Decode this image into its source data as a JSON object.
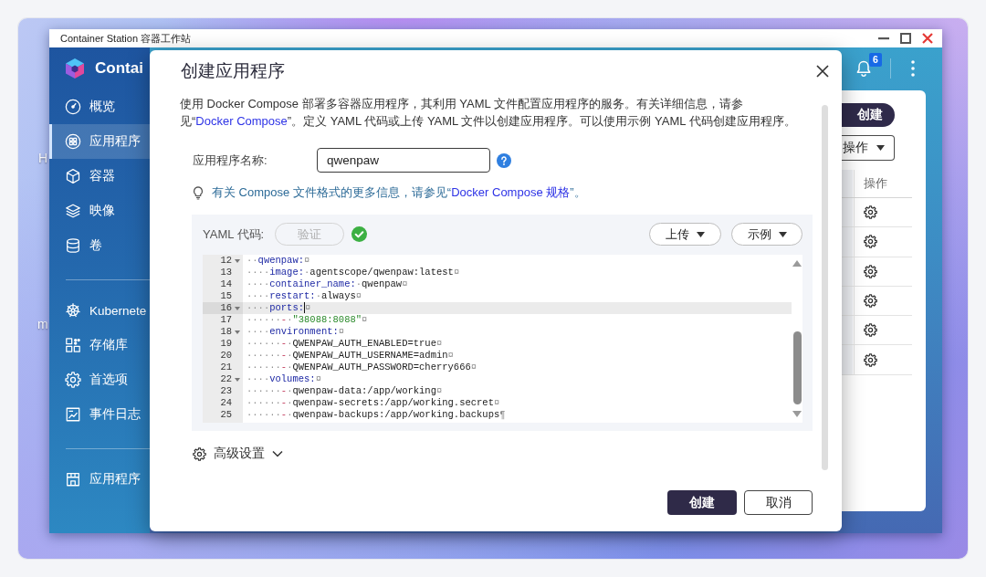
{
  "desktop": {
    "icon_labels": [
      "H",
      "m"
    ]
  },
  "window": {
    "title": "Container Station 容器工作站"
  },
  "sidebar": {
    "app_name": "Contai",
    "sections": [
      {
        "items": [
          {
            "label": "概览",
            "selected": false
          },
          {
            "label": "应用程序",
            "selected": true
          },
          {
            "label": "容器",
            "selected": false
          },
          {
            "label": "映像",
            "selected": false
          },
          {
            "label": "卷",
            "selected": false
          }
        ]
      },
      {
        "items": [
          {
            "label": "Kubernete",
            "selected": false
          },
          {
            "label": "存储库",
            "selected": false
          },
          {
            "label": "首选项",
            "selected": false
          },
          {
            "label": "事件日志",
            "selected": false
          }
        ]
      },
      {
        "items": [
          {
            "label": "应用程序",
            "selected": false
          }
        ]
      }
    ]
  },
  "header": {
    "notification_badge": "6"
  },
  "content": {
    "create_button": "创建",
    "actions_button": "操作",
    "table": {
      "columns": [
        "操作"
      ],
      "rows": [
        {
          "actions": true
        },
        {
          "actions": true
        },
        {
          "actions": true
        },
        {
          "actions": true
        },
        {
          "actions": true
        },
        {
          "actions": true
        }
      ]
    }
  },
  "dialog": {
    "title": "创建应用程序",
    "description": {
      "before": "使用 Docker Compose 部署多容器应用程序，其利用 YAML 文件配置应用程序的服务。有关详细信息，请参见“",
      "link": "Docker Compose",
      "after": "”。定义 YAML 代码或上传 YAML 文件以创建应用程序。可以使用示例 YAML 代码创建应用程序。"
    },
    "name_field": {
      "label": "应用程序名称:",
      "value": "qwenpaw"
    },
    "hint": {
      "before": "有关 Compose 文件格式的更多信息，请参见“",
      "link": "Docker Compose 规格",
      "after": "”。"
    },
    "yaml": {
      "label": "YAML 代码:",
      "validate_button": {
        "label": "验证",
        "disabled": true
      },
      "valid": true,
      "upload_button": "上传",
      "example_button": "示例",
      "editor": {
        "lines": [
          {
            "number": "12",
            "foldable": true,
            "active": false,
            "tokens": [
              {
                "kind": "ws",
                "text": "··"
              },
              {
                "kind": "key",
                "text": "qwenpaw:"
              },
              {
                "kind": "eol",
                "text": "¤"
              }
            ]
          },
          {
            "number": "13",
            "foldable": false,
            "active": false,
            "tokens": [
              {
                "kind": "ws",
                "text": "····"
              },
              {
                "kind": "key",
                "text": "image:"
              },
              {
                "kind": "ws",
                "text": "·"
              },
              {
                "kind": "plain",
                "text": "agentscope/qwenpaw:latest"
              },
              {
                "kind": "eol",
                "text": "¤"
              }
            ]
          },
          {
            "number": "14",
            "foldable": false,
            "active": false,
            "tokens": [
              {
                "kind": "ws",
                "text": "····"
              },
              {
                "kind": "key",
                "text": "container_name:"
              },
              {
                "kind": "ws",
                "text": "·"
              },
              {
                "kind": "plain",
                "text": "qwenpaw"
              },
              {
                "kind": "eol",
                "text": "¤"
              }
            ]
          },
          {
            "number": "15",
            "foldable": false,
            "active": false,
            "tokens": [
              {
                "kind": "ws",
                "text": "····"
              },
              {
                "kind": "key",
                "text": "restart:"
              },
              {
                "kind": "ws",
                "text": "·"
              },
              {
                "kind": "plain",
                "text": "always"
              },
              {
                "kind": "eol",
                "text": "¤"
              }
            ]
          },
          {
            "number": "16",
            "foldable": true,
            "active": true,
            "tokens": [
              {
                "kind": "ws",
                "text": "····"
              },
              {
                "kind": "key",
                "text": "ports:"
              },
              {
                "kind": "eol",
                "text": "¤"
              }
            ]
          },
          {
            "number": "17",
            "foldable": false,
            "active": false,
            "tokens": [
              {
                "kind": "ws",
                "text": "······"
              },
              {
                "kind": "dash",
                "text": "-"
              },
              {
                "kind": "ws",
                "text": "·"
              },
              {
                "kind": "string",
                "text": "\"38088:8088\""
              },
              {
                "kind": "eol",
                "text": "¤"
              }
            ]
          },
          {
            "number": "18",
            "foldable": true,
            "active": false,
            "tokens": [
              {
                "kind": "ws",
                "text": "····"
              },
              {
                "kind": "key",
                "text": "environment:"
              },
              {
                "kind": "eol",
                "text": "¤"
              }
            ]
          },
          {
            "number": "19",
            "foldable": false,
            "active": false,
            "tokens": [
              {
                "kind": "ws",
                "text": "······"
              },
              {
                "kind": "dash",
                "text": "-"
              },
              {
                "kind": "ws",
                "text": "·"
              },
              {
                "kind": "plain",
                "text": "QWENPAW_AUTH_ENABLED=true"
              },
              {
                "kind": "eol",
                "text": "¤"
              }
            ]
          },
          {
            "number": "20",
            "foldable": false,
            "active": false,
            "tokens": [
              {
                "kind": "ws",
                "text": "······"
              },
              {
                "kind": "dash",
                "text": "-"
              },
              {
                "kind": "ws",
                "text": "·"
              },
              {
                "kind": "plain",
                "text": "QWENPAW_AUTH_USERNAME=admin"
              },
              {
                "kind": "eol",
                "text": "¤"
              }
            ]
          },
          {
            "number": "21",
            "foldable": false,
            "active": false,
            "tokens": [
              {
                "kind": "ws",
                "text": "······"
              },
              {
                "kind": "dash",
                "text": "-"
              },
              {
                "kind": "ws",
                "text": "·"
              },
              {
                "kind": "plain",
                "text": "QWENPAW_AUTH_PASSWORD=cherry666"
              },
              {
                "kind": "eol",
                "text": "¤"
              }
            ]
          },
          {
            "number": "22",
            "foldable": true,
            "active": false,
            "tokens": [
              {
                "kind": "ws",
                "text": "····"
              },
              {
                "kind": "key",
                "text": "volumes:"
              },
              {
                "kind": "eol",
                "text": "¤"
              }
            ]
          },
          {
            "number": "23",
            "foldable": false,
            "active": false,
            "tokens": [
              {
                "kind": "ws",
                "text": "······"
              },
              {
                "kind": "dash",
                "text": "-"
              },
              {
                "kind": "ws",
                "text": "·"
              },
              {
                "kind": "plain",
                "text": "qwenpaw-data:/app/working"
              },
              {
                "kind": "eol",
                "text": "¤"
              }
            ]
          },
          {
            "number": "24",
            "foldable": false,
            "active": false,
            "tokens": [
              {
                "kind": "ws",
                "text": "······"
              },
              {
                "kind": "dash",
                "text": "-"
              },
              {
                "kind": "ws",
                "text": "·"
              },
              {
                "kind": "plain",
                "text": "qwenpaw-secrets:/app/working.secret"
              },
              {
                "kind": "eol",
                "text": "¤"
              }
            ]
          },
          {
            "number": "25",
            "foldable": false,
            "active": false,
            "tokens": [
              {
                "kind": "ws",
                "text": "······"
              },
              {
                "kind": "dash",
                "text": "-"
              },
              {
                "kind": "ws",
                "text": "·"
              },
              {
                "kind": "plain",
                "text": "qwenpaw-backups:/app/working.backups"
              },
              {
                "kind": "eol",
                "text": "¶"
              }
            ]
          }
        ]
      }
    },
    "advanced": {
      "label": "高级设置",
      "expanded": false
    },
    "buttons": [
      {
        "label": "创建",
        "kind": "primary"
      },
      {
        "label": "取消",
        "kind": "secondary"
      }
    ]
  }
}
